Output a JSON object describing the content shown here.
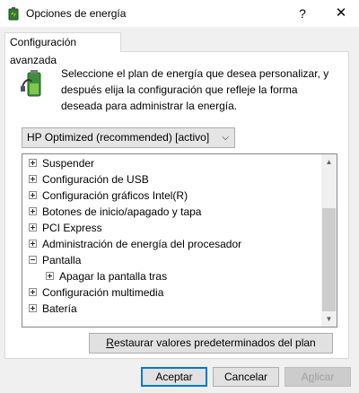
{
  "window": {
    "title": "Opciones de energía",
    "help_label": "?",
    "close_label": "✕"
  },
  "tab": {
    "label": "Configuración avanzada"
  },
  "description": "Seleccione el plan de energía que desea personalizar, y después elija la configuración que refleje la forma deseada para administrar la energía.",
  "plan_select": {
    "value": "HP Optimized (recommended) [activo]",
    "arrow": "⌵"
  },
  "tree": {
    "items": [
      {
        "label": "Suspender",
        "state": "collapsed"
      },
      {
        "label": "Configuración de USB",
        "state": "collapsed"
      },
      {
        "label": "Configuración gráficos Intel(R)",
        "state": "collapsed"
      },
      {
        "label": "Botones de inicio/apagado y tapa",
        "state": "collapsed"
      },
      {
        "label": "PCI Express",
        "state": "collapsed"
      },
      {
        "label": "Administración de energía del procesador",
        "state": "collapsed"
      },
      {
        "label": "Pantalla",
        "state": "expanded"
      },
      {
        "label": "Apagar la pantalla tras",
        "state": "collapsed"
      },
      {
        "label": "Configuración multimedia",
        "state": "collapsed"
      },
      {
        "label": "Batería",
        "state": "collapsed"
      }
    ]
  },
  "restore_button": {
    "prefix": "R",
    "rest": "estaurar valores predeterminados del plan"
  },
  "buttons": {
    "accept": "Aceptar",
    "cancel": "Cancelar",
    "apply_prefix": "A",
    "apply_mid": "p",
    "apply_rest": "licar"
  },
  "icons": {
    "app": "power-options-icon",
    "plan": "battery-plug-icon"
  }
}
